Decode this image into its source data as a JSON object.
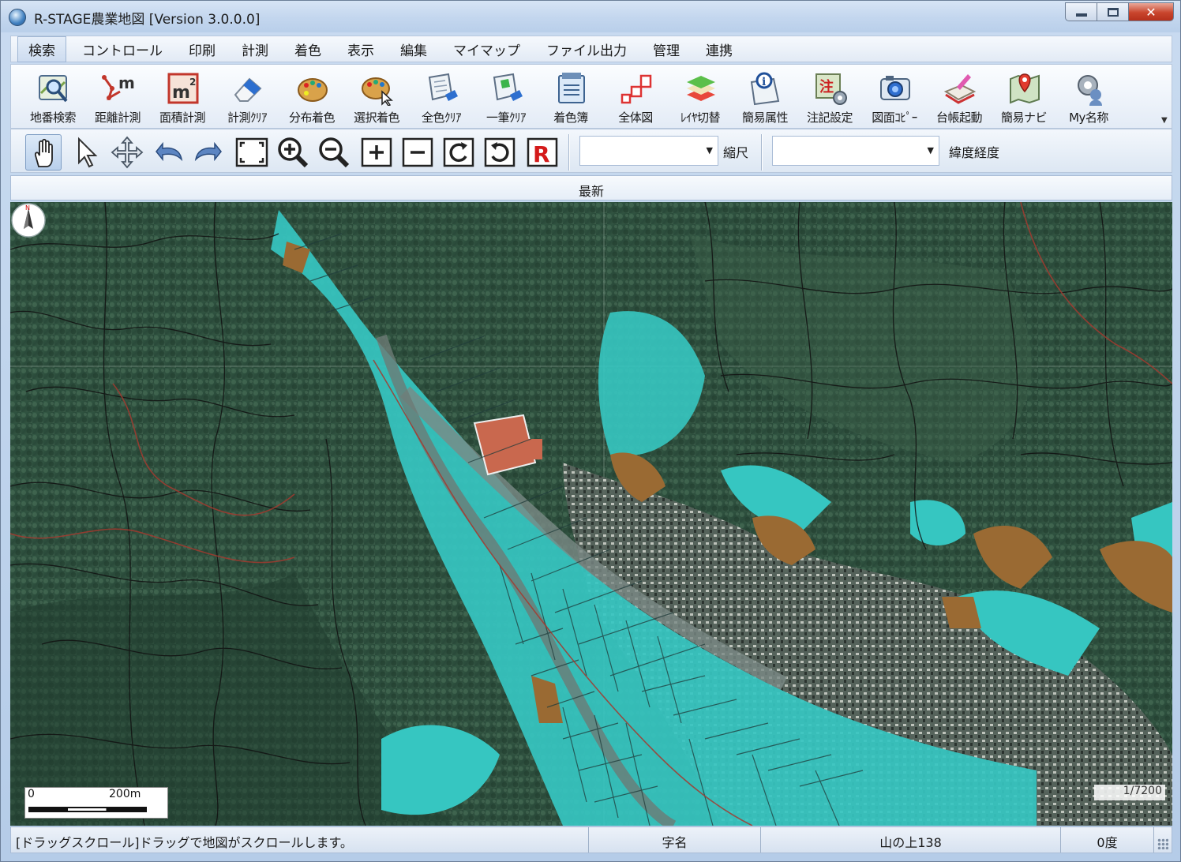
{
  "window": {
    "title": "R-STAGE農業地図 [Version 3.0.0.0]"
  },
  "menu": [
    {
      "label": "検索"
    },
    {
      "label": "コントロール"
    },
    {
      "label": "印刷"
    },
    {
      "label": "計測"
    },
    {
      "label": "着色"
    },
    {
      "label": "表示"
    },
    {
      "label": "編集"
    },
    {
      "label": "マイマップ"
    },
    {
      "label": "ファイル出力"
    },
    {
      "label": "管理"
    },
    {
      "label": "連携"
    }
  ],
  "toolbar": [
    {
      "label": "地番検索",
      "icon": "map-search-icon"
    },
    {
      "label": "距離計測",
      "icon": "distance-measure-icon"
    },
    {
      "label": "面積計測",
      "icon": "area-measure-icon"
    },
    {
      "label": "計測ｸﾘｱ",
      "icon": "eraser-icon"
    },
    {
      "label": "分布着色",
      "icon": "palette-icon"
    },
    {
      "label": "選択着色",
      "icon": "palette-select-icon"
    },
    {
      "label": "全色ｸﾘｱ",
      "icon": "clear-all-color-icon"
    },
    {
      "label": "一筆ｸﾘｱ",
      "icon": "clear-parcel-icon"
    },
    {
      "label": "着色簿",
      "icon": "color-register-icon"
    },
    {
      "label": "全体図",
      "icon": "overview-icon"
    },
    {
      "label": "ﾚｲﾔ切替",
      "icon": "layers-icon"
    },
    {
      "label": "簡易属性",
      "icon": "info-icon"
    },
    {
      "label": "注記設定",
      "icon": "annotation-settings-icon"
    },
    {
      "label": "図面ｺﾋﾟｰ",
      "icon": "camera-icon"
    },
    {
      "label": "台帳起動",
      "icon": "ledger-icon"
    },
    {
      "label": "簡易ナビ",
      "icon": "navigation-pin-icon"
    },
    {
      "label": "My名称",
      "icon": "my-name-icon"
    }
  ],
  "small_tools": [
    "pan-hand-icon",
    "select-arrow-icon",
    "move-arrows-icon",
    "undo-icon",
    "redo-icon",
    "full-extent-icon",
    "zoom-in-icon",
    "zoom-out-icon",
    "zoom-in-box-icon",
    "zoom-out-box-icon",
    "rotate-right-icon",
    "rotate-left-icon",
    "reset-r-icon"
  ],
  "scale_combo": {
    "label": "縮尺",
    "value": ""
  },
  "latlon_combo": {
    "label": "緯度経度",
    "value": ""
  },
  "header": {
    "label": "最新"
  },
  "map": {
    "scale_start": "0",
    "scale_end": "200m",
    "ratio": "1/7200",
    "colors": {
      "paddy": "#34c9c4",
      "field": "#9a6a33",
      "boundary": "#111111",
      "road_line": "#a33a2f"
    }
  },
  "status": {
    "message": "[ドラッグスクロール]ドラッグで地図がスクロールします。",
    "aza_label": "字名",
    "parcel": "山の上138",
    "angle": "0度"
  }
}
